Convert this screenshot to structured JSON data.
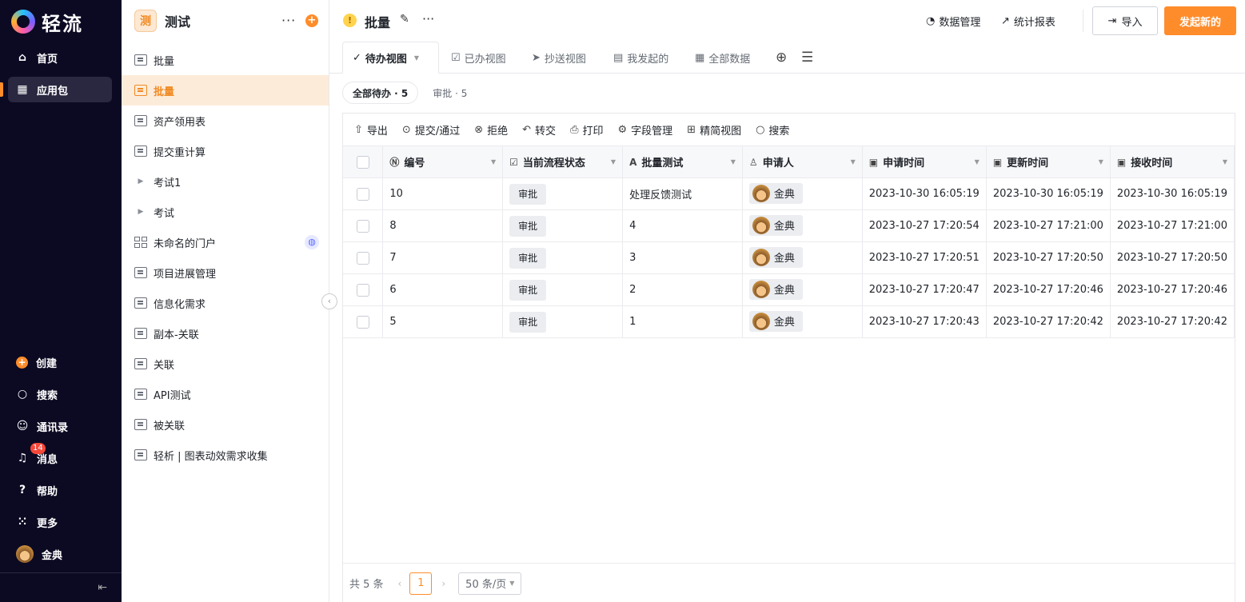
{
  "brand": {
    "name": "轻流"
  },
  "nav": {
    "items": [
      {
        "label": "首页",
        "icon": "home-icon"
      },
      {
        "label": "应用包",
        "icon": "apps-icon"
      }
    ],
    "bottom_items": [
      {
        "label": "创建",
        "icon": "plus-circle-icon"
      },
      {
        "label": "搜索",
        "icon": "search-icon"
      },
      {
        "label": "通讯录",
        "icon": "contacts-icon"
      },
      {
        "label": "消息",
        "icon": "bell-icon",
        "badge": "14"
      },
      {
        "label": "帮助",
        "icon": "help-icon"
      },
      {
        "label": "更多",
        "icon": "grid-icon"
      },
      {
        "label": "金典",
        "icon": "avatar"
      }
    ]
  },
  "sidebar": {
    "app_icon_text": "测",
    "title": "测试",
    "items": [
      {
        "label": "批量",
        "type": "form"
      },
      {
        "label": "批量",
        "type": "form",
        "active": true
      },
      {
        "label": "资产领用表",
        "type": "form"
      },
      {
        "label": "提交重计算",
        "type": "form"
      },
      {
        "label": "考试1",
        "type": "folder"
      },
      {
        "label": "考试",
        "type": "folder"
      },
      {
        "label": "未命名的门户",
        "type": "portal"
      },
      {
        "label": "项目进展管理",
        "type": "form"
      },
      {
        "label": "信息化需求",
        "type": "form"
      },
      {
        "label": "副本-关联",
        "type": "form"
      },
      {
        "label": "关联",
        "type": "form"
      },
      {
        "label": "API测试",
        "type": "form"
      },
      {
        "label": "被关联",
        "type": "form"
      },
      {
        "label": "轻析 | 图表动效需求收集",
        "type": "form"
      }
    ]
  },
  "header": {
    "title": "批量",
    "data_manage": "数据管理",
    "stats_report": "统计报表",
    "import_label": "导入",
    "new_label": "发起新的"
  },
  "tabs": [
    "待办视图",
    "已办视图",
    "抄送视图",
    "我发起的",
    "全部数据"
  ],
  "chips": [
    "全部待办 · 5",
    "审批 · 5"
  ],
  "toolbar": [
    "导出",
    "提交/通过",
    "拒绝",
    "转交",
    "打印",
    "字段管理",
    "精简视图",
    "搜索"
  ],
  "table": {
    "columns": [
      "编号",
      "当前流程状态",
      "批量测试",
      "申请人",
      "申请时间",
      "更新时间",
      "接收时间"
    ],
    "rows": [
      {
        "id": "10",
        "status": "审批",
        "test": "处理反馈测试",
        "applicant": "金典",
        "applied": "2023-10-30 16:05:19",
        "updated": "2023-10-30 16:05:19",
        "received": "2023-10-30 16:05:19"
      },
      {
        "id": "8",
        "status": "审批",
        "test": "4",
        "applicant": "金典",
        "applied": "2023-10-27 17:20:54",
        "updated": "2023-10-27 17:21:00",
        "received": "2023-10-27 17:21:00"
      },
      {
        "id": "7",
        "status": "审批",
        "test": "3",
        "applicant": "金典",
        "applied": "2023-10-27 17:20:51",
        "updated": "2023-10-27 17:20:50",
        "received": "2023-10-27 17:20:50"
      },
      {
        "id": "6",
        "status": "审批",
        "test": "2",
        "applicant": "金典",
        "applied": "2023-10-27 17:20:47",
        "updated": "2023-10-27 17:20:46",
        "received": "2023-10-27 17:20:46"
      },
      {
        "id": "5",
        "status": "审批",
        "test": "1",
        "applicant": "金典",
        "applied": "2023-10-27 17:20:43",
        "updated": "2023-10-27 17:20:42",
        "received": "2023-10-27 17:20:42"
      }
    ]
  },
  "pagination": {
    "total": "共 5 条",
    "current": "1",
    "page_size": "50 条/页"
  },
  "colors": {
    "accent": "#ff8c2b",
    "nav_bg": "#0c0a23"
  }
}
